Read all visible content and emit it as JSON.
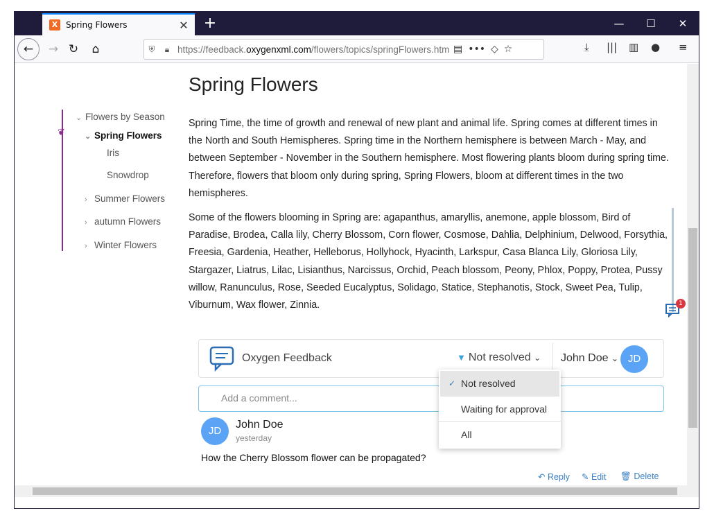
{
  "browser": {
    "tab_title": "Spring Flowers",
    "tab_favicon": "X",
    "url_prefix": "https://feedback.",
    "url_domain": "oxygenxml.com",
    "url_suffix": "/flowers/topics/springFlowers.htm"
  },
  "page": {
    "title": "Spring Flowers",
    "paragraph1": "Spring Time, the time of growth and renewal of new plant and animal life. Spring comes at different times in the North and South Hemispheres. Spring time in the Northern hemisphere is between March - May, and between September - November in the Southern hemisphere. Most flowering plants bloom during spring time. Therefore, flowers that bloom only during spring, Spring Flowers, bloom at different times in the two hemispheres.",
    "paragraph2": "Some of the flowers blooming in Spring are: agapanthus, amaryllis, anemone, apple blossom, Bird of Paradise, Brodea, Calla lily, Cherry Blossom, Corn flower, Cosmose, Dahlia, Delphinium, Delwood, Forsythia, Freesia, Gardenia, Heather, Helleborus, Hollyhock, Hyacinth, Larkspur, Casa Blanca Lily, Gloriosa Lily, Stargazer, Liatrus, Lilac, Lisianthus, Narcissus, Orchid, Peach blossom, Peony, Phlox, Poppy, Protea, Pussy willow, Ranunculus, Rose, Seeded Eucalyptus, Solidago, Statice, Stephanotis, Stock, Sweet Pea, Tulip, Viburnum, Wax flower, Zinnia.",
    "comment_badge": "1"
  },
  "toc": {
    "root": "Flowers by Season",
    "active": "Spring Flowers",
    "children": [
      "Iris",
      "Snowdrop"
    ],
    "summer": "Summer Flowers",
    "autumn": "autumn Flowers",
    "winter": "Winter Flowers"
  },
  "feedback": {
    "title": "Oxygen Feedback",
    "filter": "Not resolved",
    "user": "John Doe",
    "user_initials": "JD",
    "comment_placeholder": "Add a comment...",
    "comment": {
      "author": "John Doe",
      "initials": "JD",
      "time": "yesterday",
      "text": "How the Cherry Blossom flower can be propagated?",
      "reply": "Reply",
      "edit": "Edit",
      "delete": "Delete"
    },
    "dropdown": [
      "Not resolved",
      "Waiting for approval",
      "All"
    ]
  },
  "colors": {
    "accent": "#3b82c4",
    "toc_line": "#8b2a8f",
    "avatar": "#5ba4f5",
    "badge": "#d9363e"
  }
}
